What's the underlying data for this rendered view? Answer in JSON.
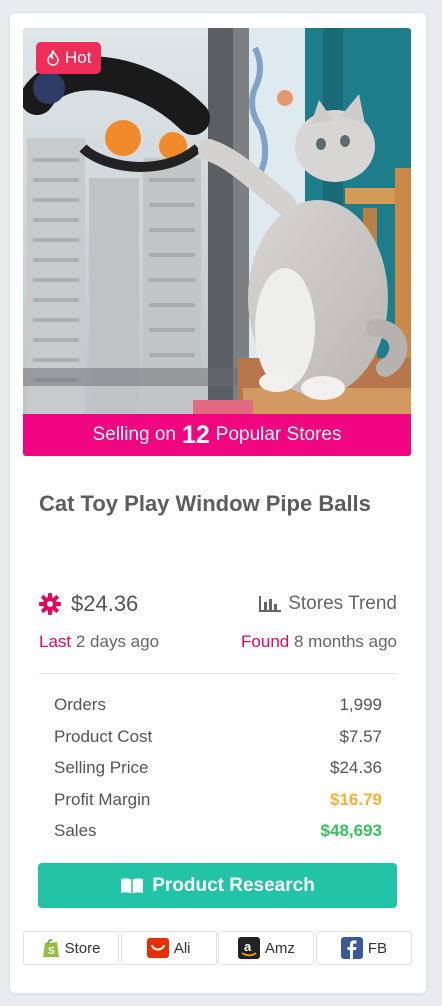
{
  "card": {
    "badge": "Hot",
    "selling": {
      "prefix": "Selling on",
      "count": "12",
      "suffix": "Popular Stores"
    },
    "title": "Cat Toy Play Window Pipe Balls",
    "price": "$24.36",
    "trend_label": "Stores Trend",
    "last": {
      "label": "Last",
      "value": "2 days ago"
    },
    "found": {
      "label": "Found",
      "value": "8 months ago"
    },
    "stats": [
      {
        "label": "Orders",
        "value": "1,999"
      },
      {
        "label": "Product Cost",
        "value": "$7.57"
      },
      {
        "label": "Selling Price",
        "value": "$24.36"
      },
      {
        "label": "Profit Margin",
        "value": "$16.79"
      },
      {
        "label": "Sales",
        "value": "$48,693"
      }
    ],
    "button": "Product Research",
    "links": [
      {
        "label": "Store",
        "icon": "shopify-icon"
      },
      {
        "label": "Ali",
        "icon": "aliexpress-icon"
      },
      {
        "label": "Amz",
        "icon": "amazon-icon"
      },
      {
        "label": "FB",
        "icon": "facebook-icon"
      }
    ]
  },
  "colors": {
    "hot": "#ee2d59",
    "selling_bar": "#f0047f",
    "accent_pink": "#e2075e",
    "profit": "#f4b23a",
    "sales": "#3cbf63",
    "button": "#22c3a6"
  }
}
